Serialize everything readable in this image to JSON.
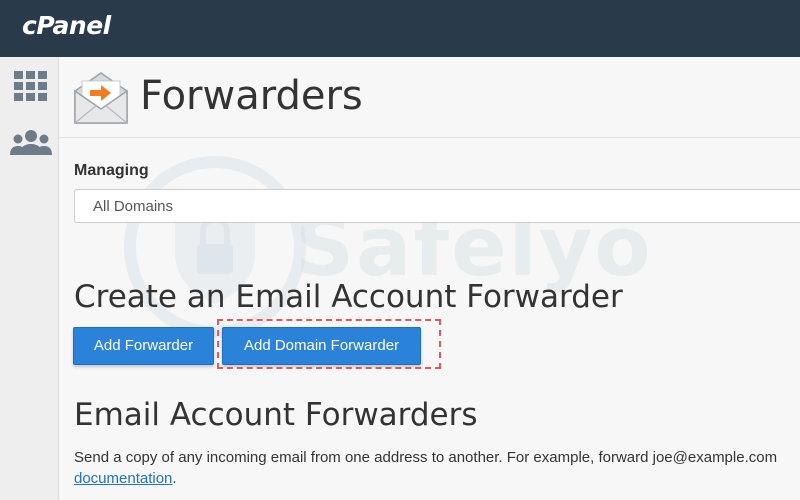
{
  "app": {
    "logo": "cPanel"
  },
  "sidebar": {
    "items": [
      {
        "icon": "grid-icon"
      },
      {
        "icon": "users-icon"
      }
    ]
  },
  "page": {
    "title": "Forwarders",
    "icon": "envelope-forward-icon"
  },
  "managing": {
    "label": "Managing",
    "selected": "All Domains"
  },
  "create_section": {
    "title": "Create an Email Account Forwarder",
    "buttons": {
      "add_forwarder": "Add Forwarder",
      "add_domain_forwarder": "Add Domain Forwarder"
    }
  },
  "forwarders_section": {
    "title": "Email Account Forwarders",
    "description": "Send a copy of any incoming email from one address to another. For example, forward joe@example.com",
    "doc_link": "documentation",
    "doc_suffix": "."
  },
  "watermark": {
    "text": "Safelyo"
  },
  "colors": {
    "topbar": "#293a4a",
    "button": "#2b82d9",
    "highlight": "#e05a5a",
    "link": "#1f74c8"
  }
}
